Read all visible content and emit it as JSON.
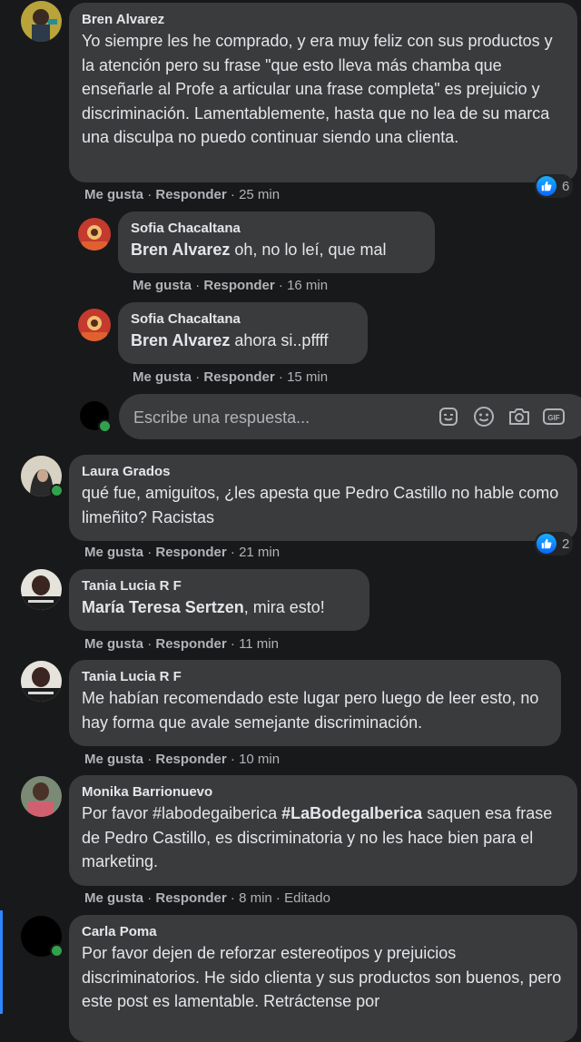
{
  "colors": {
    "background": "#18191a",
    "bubble": "#3a3b3c",
    "like_blue": "#0866ff",
    "online_green": "#31a24c"
  },
  "comments": [
    {
      "author": "Bren Alvarez",
      "text": "Yo siempre les he comprado, y era muy feliz con sus productos y la atención pero su frase \"que esto lleva más chamba que enseñarle al Profe a articular una frase completa\" es prejuicio y discriminación. Lamentablemente, hasta que no lea de su marca una disculpa no puedo continuar siendo una clienta.",
      "like": "Me gusta",
      "sep1": "·",
      "reply": "Responder",
      "sep2": "·",
      "time": "25 min",
      "reaction_count": "6",
      "replies": [
        {
          "author": "Sofia Chacaltana",
          "mention": "Bren Alvarez",
          "text": " oh, no lo leí, que mal",
          "like": "Me gusta",
          "sep1": "·",
          "reply": "Responder",
          "sep2": "·",
          "time": "16 min"
        },
        {
          "author": "Sofia Chacaltana",
          "mention": "Bren Alvarez",
          "text": " ahora si..pffff",
          "like": "Me gusta",
          "sep1": "·",
          "reply": "Responder",
          "sep2": "·",
          "time": "15 min"
        }
      ]
    },
    {
      "author": "Laura Grados",
      "text": "qué fue, amiguitos, ¿les apesta que Pedro Castillo no hable como limeñito? Racistas",
      "like": "Me gusta",
      "sep1": "·",
      "reply": "Responder",
      "sep2": "·",
      "time": "21 min",
      "reaction_count": "2"
    },
    {
      "author": "Tania Lucia R F",
      "mention": "María Teresa Sertzen",
      "text": ", mira esto!",
      "like": "Me gusta",
      "sep1": "·",
      "reply": "Responder",
      "sep2": "·",
      "time": "11 min"
    },
    {
      "author": "Tania Lucia R F",
      "text": "Me habían recomendado este lugar pero luego de leer esto, no hay forma que avale semejante discriminación.",
      "like": "Me gusta",
      "sep1": "·",
      "reply": "Responder",
      "sep2": "·",
      "time": "10 min"
    },
    {
      "author": "Monika Barrionuevo",
      "text_a": "Por favor #labodegaiberica ",
      "mention": "#LaBodegaIberica",
      "text_b": " saquen esa frase de Pedro Castillo, es discriminatoria y no les hace bien para el marketing.",
      "like": "Me gusta",
      "sep1": "·",
      "reply": "Responder",
      "sep2": "·",
      "time": "8 min",
      "sep3": "·",
      "edited": "Editado"
    },
    {
      "author": "Carla Poma",
      "text": "Por favor dejen de reforzar estereotipos y prejuicios discriminatorios. He sido clienta y sus productos son buenos, pero este post es lamentable. Retráctense por"
    }
  ],
  "reply_box": {
    "placeholder": "Escribe una respuesta..."
  },
  "icons": [
    "sticker-icon",
    "emoji-icon",
    "camera-icon",
    "gif-icon",
    "like-icon"
  ],
  "gif_label": "GIF"
}
